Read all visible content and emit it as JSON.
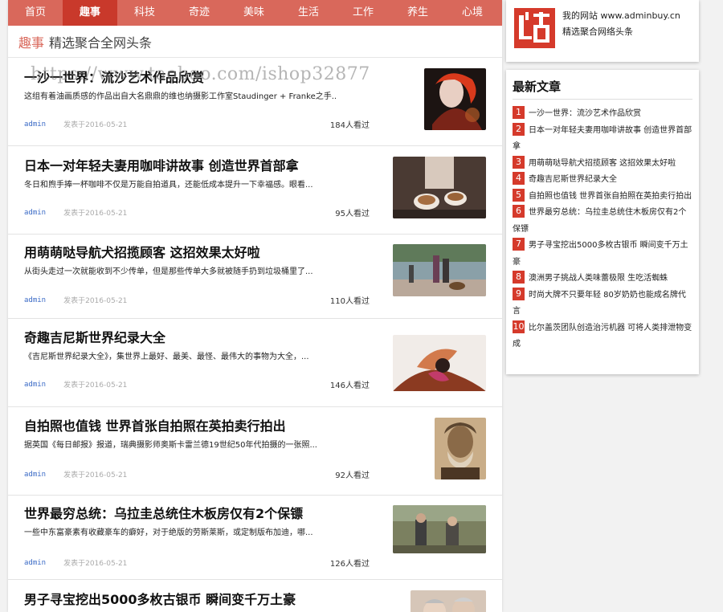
{
  "nav": {
    "items": [
      {
        "label": "首页",
        "active": false
      },
      {
        "label": "趣事",
        "active": true
      },
      {
        "label": "科技",
        "active": false
      },
      {
        "label": "奇迹",
        "active": false
      },
      {
        "label": "美味",
        "active": false
      },
      {
        "label": "生活",
        "active": false
      },
      {
        "label": "工作",
        "active": false
      },
      {
        "label": "养生",
        "active": false
      },
      {
        "label": "心境",
        "active": false
      }
    ]
  },
  "section": {
    "category": "趣事",
    "subtitle": "精选聚合全网头条"
  },
  "watermark": "https://www.taobao.com/ishop32877",
  "articles": [
    {
      "title": "一沙一世界：流沙艺术作品欣赏",
      "excerpt": "这组有着油画质感的作品出自大名鼎鼎的维也纳摄影工作室Staudinger + Franke之手...",
      "author": "admin",
      "date": "发表于2016-05-21",
      "views": "184人看过"
    },
    {
      "title": "日本一对年轻夫妻用咖啡讲故事 创造世界首部拿",
      "excerpt": "冬日和煦手捧一杯咖啡不仅是万能自拍道具，还能低成本提升一下幸福感。眼看...",
      "author": "admin",
      "date": "发表于2016-05-21",
      "views": "95人看过"
    },
    {
      "title": "用萌萌哒导航犬招揽顾客 这招效果太好啦",
      "excerpt": "从街头走过一次就能收到不少传单，但是那些传单大多就被随手扔到垃圾桶里了...",
      "author": "admin",
      "date": "发表于2016-05-21",
      "views": "110人看过"
    },
    {
      "title": "奇趣吉尼斯世界纪录大全",
      "excerpt": "《吉尼斯世界纪录大全》，集世界上最好、最美、最怪、最伟大的事物为大全，...",
      "author": "admin",
      "date": "发表于2016-05-21",
      "views": "146人看过"
    },
    {
      "title": "自拍照也值钱 世界首张自拍照在英拍卖行拍出",
      "excerpt": "据英国《每日邮报》报道，瑞典摄影师奥斯卡雷兰德19世纪50年代拍摄的一张照...",
      "author": "admin",
      "date": "发表于2016-05-21",
      "views": "92人看过"
    },
    {
      "title": "世界最穷总统：乌拉圭总统住木板房仅有2个保镖",
      "excerpt": "一些中东富豪素有收藏豪车的癖好，对于绝版的劳斯莱斯，或定制版布加迪，哪...",
      "author": "admin",
      "date": "发表于2016-05-21",
      "views": "126人看过"
    },
    {
      "title": "男子寻宝挖出5000多枚古银币 瞬间变千万土豪",
      "excerpt": "",
      "author": "",
      "date": "",
      "views": ""
    }
  ],
  "brand": {
    "logo_char": "站",
    "line1": "我的网站 www.adminbuy.cn",
    "line2": "精选聚合网络头条"
  },
  "latest": {
    "heading": "最新文章",
    "items": [
      {
        "num": "1",
        "title": "一沙一世界：流沙艺术作品欣赏"
      },
      {
        "num": "2",
        "title": "日本一对年轻夫妻用咖啡讲故事 创造世界首部拿"
      },
      {
        "num": "3",
        "title": "用萌萌哒导航犬招揽顾客 这招效果太好啦"
      },
      {
        "num": "4",
        "title": "奇趣吉尼斯世界纪录大全"
      },
      {
        "num": "5",
        "title": "自拍照也值钱 世界首张自拍照在英拍卖行拍出"
      },
      {
        "num": "6",
        "title": "世界最穷总统：乌拉圭总统住木板房仅有2个保镖"
      },
      {
        "num": "7",
        "title": "男子寻宝挖出5000多枚古银币 瞬间变千万土豪"
      },
      {
        "num": "8",
        "title": "澳洲男子挑战人类味蕾极限 生吃活蜘蛛"
      },
      {
        "num": "9",
        "title": "时尚大牌不只要年轻 80岁奶奶也能成名牌代言"
      },
      {
        "num": "10",
        "title": "比尔盖茨团队创造治污机器 可将人类排泄物变成"
      }
    ]
  },
  "colors": {
    "nav_bg": "#d9685b",
    "nav_active": "#c9392b",
    "brand_red": "#d53a2b",
    "author_blue": "#3a6ac6"
  }
}
